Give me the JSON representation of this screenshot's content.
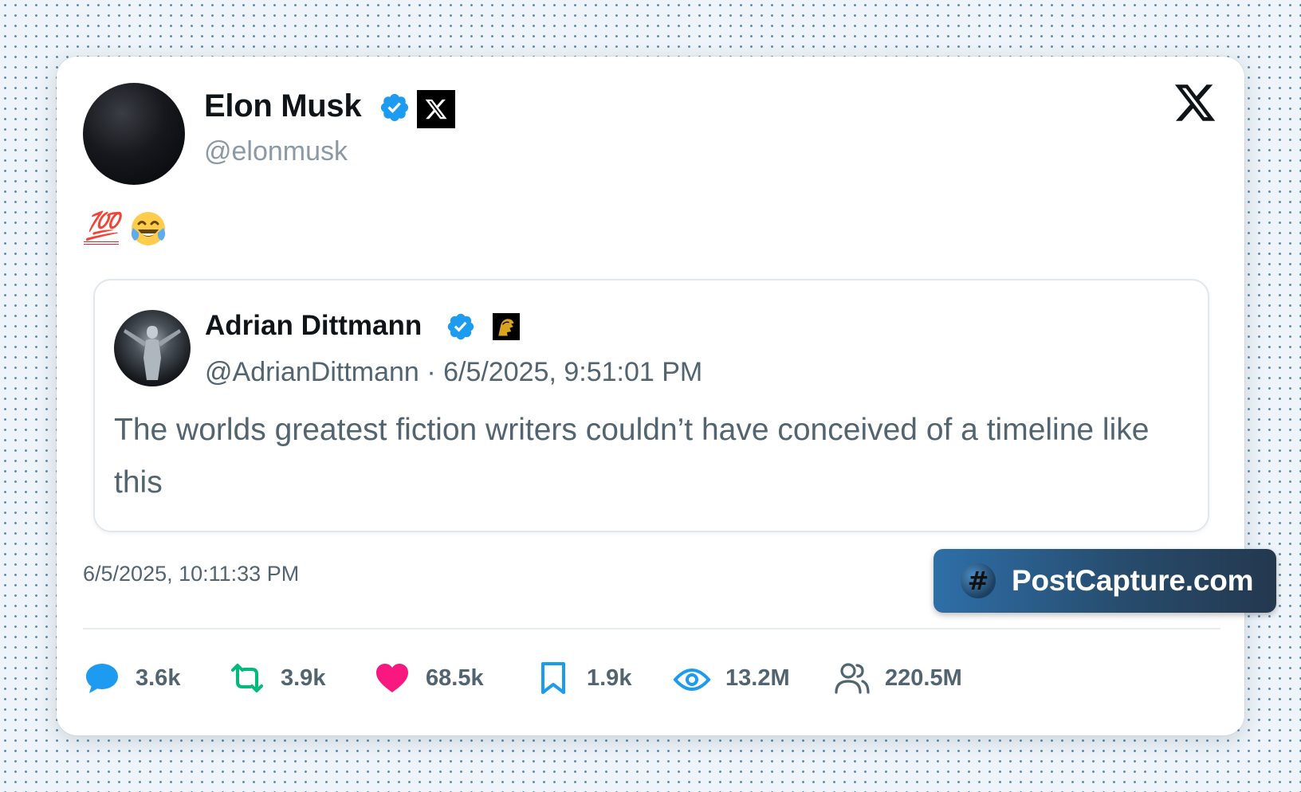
{
  "author": {
    "name": "Elon Musk",
    "handle": "@elonmusk",
    "verified_color": "#1d9bf0"
  },
  "post": {
    "emojis": [
      "💯",
      "😂"
    ],
    "timestamp": "6/5/2025, 10:11:33 PM"
  },
  "quote": {
    "name": "Adrian Dittmann",
    "handle": "@AdrianDittmann",
    "separator": "·",
    "time": "6/5/2025, 9:51:01 PM",
    "text": "The worlds greatest fiction writers couldn’t have conceived of a timeline like this"
  },
  "brand": {
    "label": "PostCapture.com",
    "icon_glyph": "#"
  },
  "stats": {
    "replies": "3.6k",
    "reposts": "3.9k",
    "likes": "68.5k",
    "bookmarks": "1.9k",
    "views": "13.2M",
    "followers": "220.5M"
  },
  "colors": {
    "reply": "#1d9bf0",
    "repost": "#00ba7c",
    "like": "#f91880",
    "bookmark": "#1d9bf0",
    "views": "#1d9bf0",
    "followers": "#536471"
  }
}
